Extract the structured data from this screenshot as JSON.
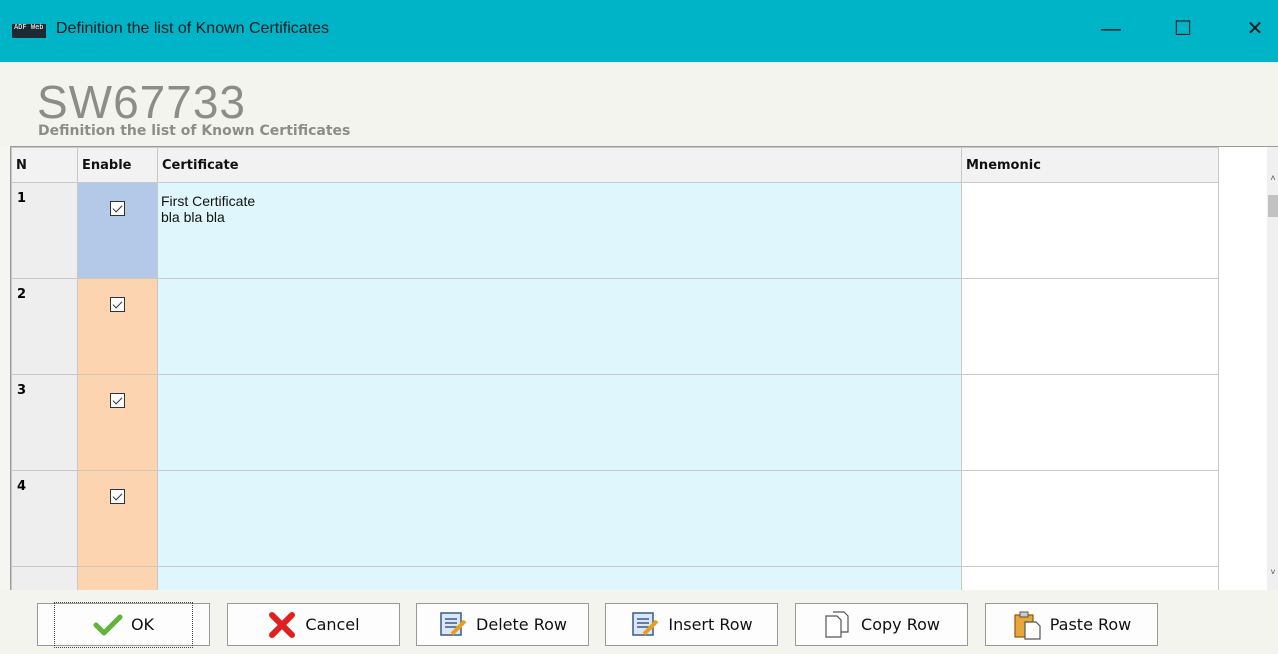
{
  "window": {
    "title": "Definition the list of Known Certificates",
    "app_icon_text": "ADF Web",
    "controls": {
      "minimize": "—",
      "maximize": "☐",
      "close": "✕"
    }
  },
  "header": {
    "title": "SW67733",
    "subtitle": "Definition the list of Known Certificates"
  },
  "grid": {
    "columns": [
      "N",
      "Enable",
      "Certificate",
      "Mnemonic"
    ],
    "rows": [
      {
        "n": "1",
        "enabled": true,
        "certificate_line1": "First Certificate",
        "certificate_line2": "bla bla bla",
        "mnemonic": ""
      },
      {
        "n": "2",
        "enabled": true,
        "certificate_line1": "",
        "certificate_line2": "",
        "mnemonic": ""
      },
      {
        "n": "3",
        "enabled": true,
        "certificate_line1": "",
        "certificate_line2": "",
        "mnemonic": ""
      },
      {
        "n": "4",
        "enabled": true,
        "certificate_line1": "",
        "certificate_line2": "",
        "mnemonic": ""
      }
    ],
    "scroll": {
      "up": "˄",
      "down": "˅"
    }
  },
  "buttons": {
    "ok": "OK",
    "cancel": "Cancel",
    "delete_row": "Delete Row",
    "insert_row": "Insert Row",
    "copy_row": "Copy Row",
    "paste_row": "Paste Row"
  },
  "colors": {
    "titlebar": "#00b4c8",
    "enable_selected": "#b4c8e8",
    "enable_cell": "#fcd4b0",
    "certificate_cell": "#dff7fc"
  }
}
